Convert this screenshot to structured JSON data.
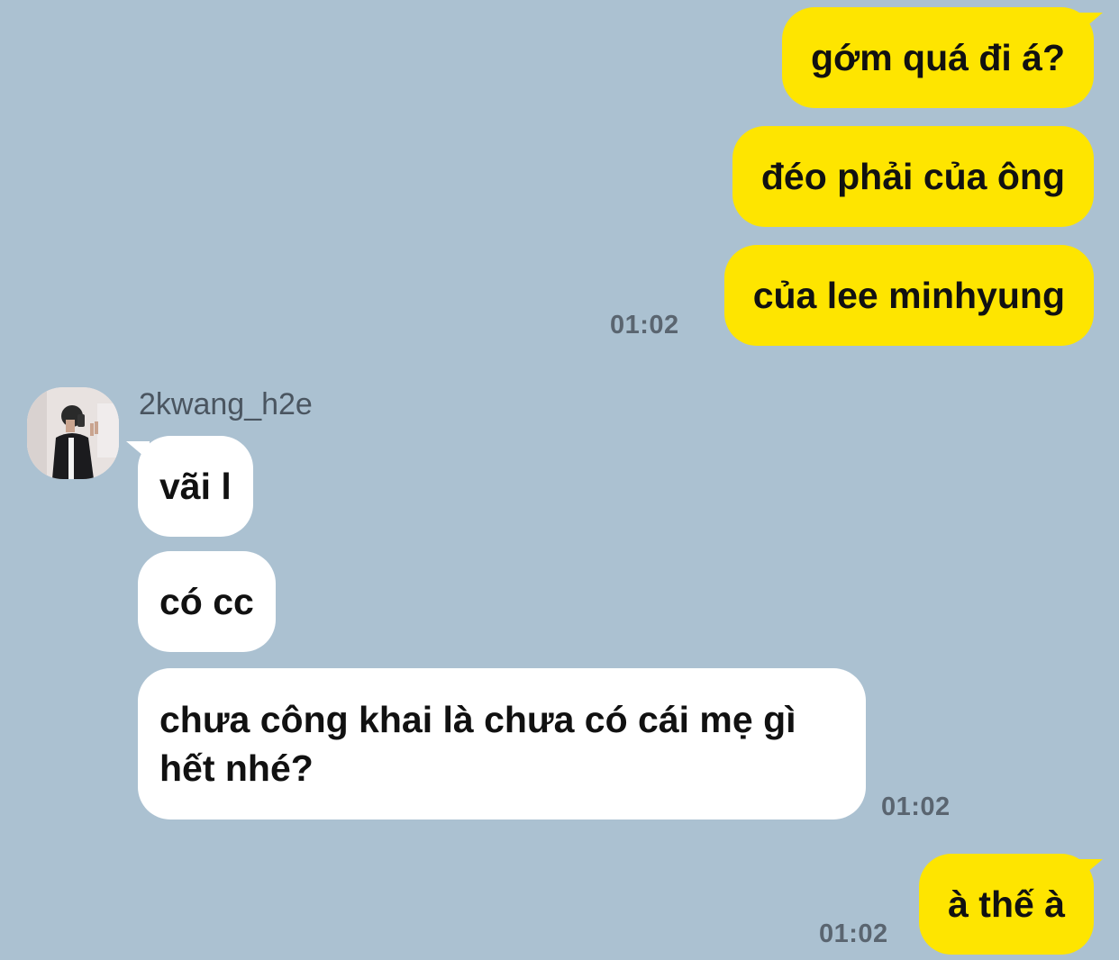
{
  "chat": {
    "sender_name": "2kwang_h2e",
    "sent_group_1": {
      "messages": [
        "gớm quá đi á?",
        "đéo phải của ông",
        "của lee minhyung"
      ],
      "time": "01:02"
    },
    "received_group": {
      "messages": [
        "vãi l",
        "có cc",
        "chưa công khai là chưa có cái mẹ gì hết nhé?"
      ],
      "time": "01:02"
    },
    "sent_group_2": {
      "messages": [
        "à thế à"
      ],
      "time": "01:02"
    }
  },
  "colors": {
    "background": "#abc1d1",
    "my_bubble": "#fee500",
    "their_bubble": "#ffffff",
    "timestamp": "#5a6570"
  },
  "icons": {
    "avatar": "profile-photo-avatar"
  }
}
